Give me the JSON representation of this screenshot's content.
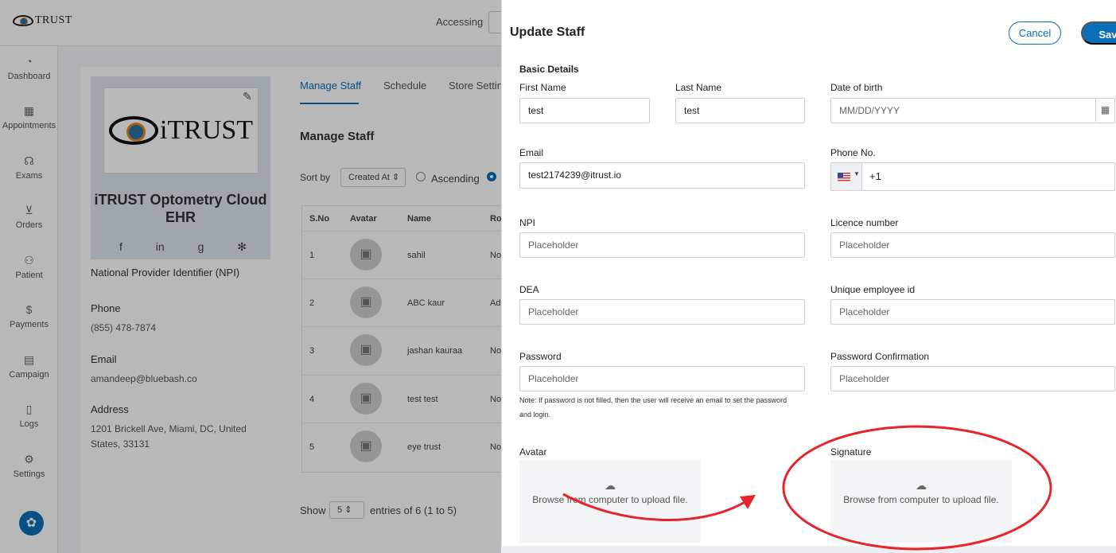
{
  "app": {
    "logo_text": "TRUST",
    "accessing_label": "Accessing"
  },
  "sidenav": {
    "items": [
      {
        "label": "Dashboard",
        "icon": "dashboard-icon"
      },
      {
        "label": "Appointments",
        "icon": "calendar-icon"
      },
      {
        "label": "Exams",
        "icon": "stethoscope-icon"
      },
      {
        "label": "Orders",
        "icon": "cart-icon"
      },
      {
        "label": "Patient",
        "icon": "patient-icon"
      },
      {
        "label": "Payments",
        "icon": "dollar-icon"
      },
      {
        "label": "Campaign",
        "icon": "message-icon"
      },
      {
        "label": "Logs",
        "icon": "document-icon"
      },
      {
        "label": "Settings",
        "icon": "gear-icon"
      }
    ]
  },
  "profile": {
    "logo_text": "iTRUST",
    "org_name": "iTRUST Optometry Cloud EHR",
    "npi_label": "National Provider Identifier (NPI)",
    "phone_label": "Phone",
    "phone_value": "(855) 478-7874",
    "email_label": "Email",
    "email_value": "amandeep@bluebash.co",
    "address_label": "Address",
    "address_value": "1201 Brickell Ave, Miami, DC, United States, 33131"
  },
  "staff_page": {
    "tabs": [
      "Manage Staff",
      "Schedule",
      "Store Settin"
    ],
    "title": "Manage Staff",
    "sort_label": "Sort by",
    "sort_value": "Created At",
    "ascending_label": "Ascending",
    "columns": [
      "S.No",
      "Avatar",
      "Name",
      "Ro"
    ],
    "rows": [
      {
        "sno": "1",
        "name": "sahil",
        "role": "No"
      },
      {
        "sno": "2",
        "name": "ABC kaur",
        "role": "Ad"
      },
      {
        "sno": "3",
        "name": "jashan kauraa",
        "role": "No"
      },
      {
        "sno": "4",
        "name": "test test",
        "role": "No"
      },
      {
        "sno": "5",
        "name": "eye trust",
        "role": "No"
      }
    ],
    "show_label": "Show",
    "page_size": "5",
    "entries_text": "entries of 6 (1 to 5)"
  },
  "drawer": {
    "title": "Update Staff",
    "cancel_label": "Cancel",
    "save_label": "Save",
    "section_title": "Basic Details",
    "first_name_label": "First Name",
    "first_name_value": "test",
    "last_name_label": "Last Name",
    "last_name_value": "test",
    "dob_label": "Date of birth",
    "dob_placeholder": "MM/DD/YYYY",
    "email_label": "Email",
    "email_value": "test2174239@itrust.io",
    "phone_label": "Phone No.",
    "phone_code": "+1",
    "npi_label": "NPI",
    "licence_label": "Licence number",
    "dea_label": "DEA",
    "employee_id_label": "Unique employee id",
    "password_label": "Password",
    "password_confirm_label": "Password Confirmation",
    "placeholder": "Placeholder",
    "password_note": "Note: If password is not filled, then the user will receive an email to set the password and login.",
    "avatar_label": "Avatar",
    "signature_label": "Signature",
    "upload_text": "Browse from computer to upload file."
  },
  "colors": {
    "primary": "#0b6fb8",
    "annotation": "#e4262c"
  }
}
